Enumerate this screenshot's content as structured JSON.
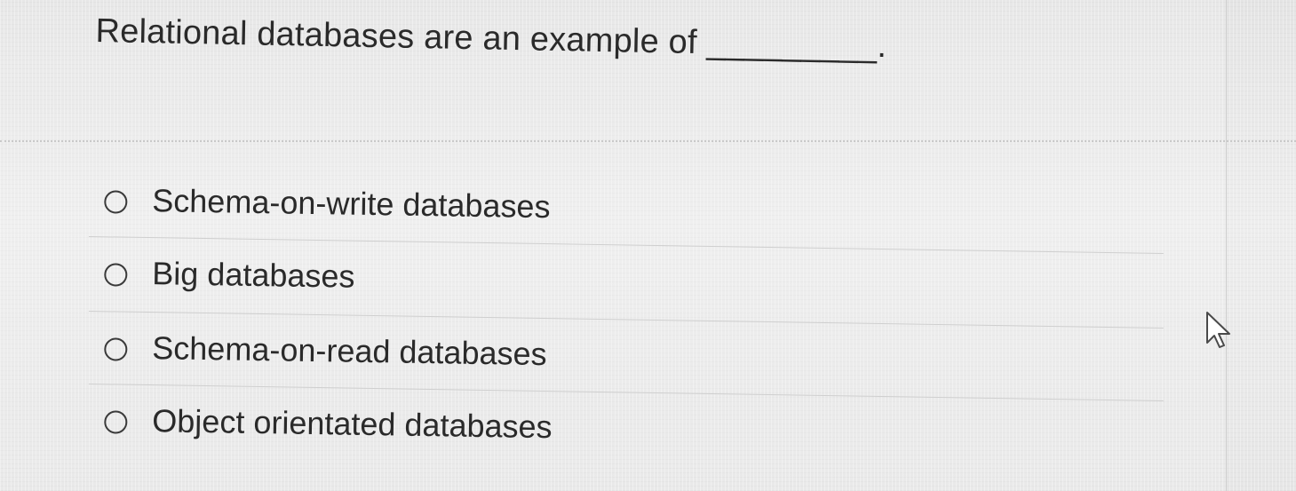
{
  "question": {
    "text": "Relational databases are an example of _________."
  },
  "answers": [
    {
      "label": "Schema-on-write databases",
      "selected": false
    },
    {
      "label": "Big databases",
      "selected": false
    },
    {
      "label": "Schema-on-read databases",
      "selected": false
    },
    {
      "label": "Object orientated databases",
      "selected": false
    }
  ],
  "cursor": {
    "icon": "mouse-pointer-icon"
  }
}
